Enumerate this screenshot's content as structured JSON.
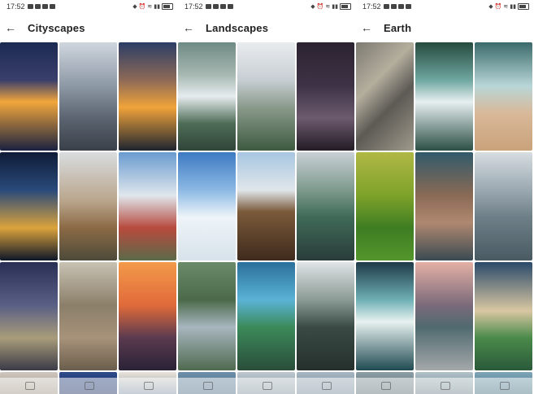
{
  "screens": [
    {
      "status_time": "17:52",
      "title": "Cityscapes",
      "tiles": [
        "linear-gradient(180deg,#1c2a52 0%,#3a3f6b 35%,#f2a63b 55%,#1a2140 100%)",
        "linear-gradient(180deg,#cfd6de 0%,#8e99a6 40%,#5b6470 70%,#3a4049 100%)",
        "linear-gradient(180deg,#2c3d66 0%,#8e6a57 35%,#f0a33a 60%,#1e2430 100%)",
        "linear-gradient(180deg,#0f1b37 0%,#294a7a 35%,#dba33c 70%,#0e1628 100%)",
        "linear-gradient(180deg,#d9dde0 0%,#b9a58c 45%,#8b6a45 70%,#4d4a3a 100%)",
        "linear-gradient(180deg,#6a9bd0 0%,#dfe6ec 40%,#b74a3e 70%,#5a6a48 100%)",
        "linear-gradient(180deg,#2a2f55 0%,#5a5f85 40%,#a89c7a 70%,#3b3a48 100%)",
        "linear-gradient(180deg,#c8c2b3 0%,#8b7f6a 40%,#a8927a 70%,#6a5e4c 100%)",
        "linear-gradient(180deg,#f39a4a 0%,#e06a3a 40%,#5a3a4f 70%,#2a2236 100%)",
        "linear-gradient(180deg,#cfc7be 0%,#9a8e80 100%)",
        "linear-gradient(180deg,#2e4a8a 0%,#1c2f60 100%)",
        "linear-gradient(180deg,#e9e2d8 0%,#7a8ea0 100%)"
      ]
    },
    {
      "status_time": "17:52",
      "title": "Landscapes",
      "tiles": [
        "linear-gradient(180deg,#6f8a84 0%,#a7b8b2 30%,#e6ecee 50%,#4e6c57 75%,#2f4538 100%)",
        "linear-gradient(180deg,#e9ecef 0%,#c7ced3 35%,#8a9a8c 60%,#3d5a3f 100%)",
        "linear-gradient(180deg,#2b2230 0%,#3e3346 40%,#6c5a6e 70%,#231b25 100%)",
        "linear-gradient(180deg,#3d7ac2 0%,#8cb9e4 35%,#eef4f8 60%,#d7e2ea 100%)",
        "linear-gradient(180deg,#a7c6e1 0%,#e0e6ea 35%,#7a5a3a 55%,#3f2a1d 100%)",
        "linear-gradient(180deg,#c9d0d5 0%,#7e9a8d 35%,#3f6a57 60%,#2a3c3a 100%)",
        "linear-gradient(180deg,#6a8a6a 0%,#4c6a4a 35%,#a8b6bf 60%,#4f6a4f 100%)",
        "linear-gradient(180deg,#2b6f9a 0%,#5ab3d6 35%,#3c8a5a 60%,#2a4d3a 100%)",
        "linear-gradient(180deg,#e0e4e6 0%,#8a9a94 35%,#3a4a44 60%,#25302c 100%)",
        "linear-gradient(180deg,#6d8fa9 0%,#4b6b82 100%)",
        "linear-gradient(180deg,#bcc7cf 0%,#7f8f99 100%)",
        "linear-gradient(180deg,#a7b7c3 0%,#6f8492 100%)"
      ]
    },
    {
      "status_time": "17:52",
      "title": "Earth",
      "tiles": [
        "linear-gradient(135deg,#7d7a72 0%,#b4ae9d 35%,#5d5a55 60%,#9f9a8c 100%)",
        "linear-gradient(180deg,#264a3e 0%,#6fa7a1 35%,#e6eff0 55%,#2c4f44 100%)",
        "linear-gradient(180deg,#3b6a6a 0%,#b8d6d8 40%,#d8b99a 65%,#c9a27a 100%)",
        "linear-gradient(180deg,#b0b844 0%,#7ea22a 40%,#3e7d22 70%,#54962c 100%)",
        "linear-gradient(180deg,#315a6b 0%,#8a6a55 40%,#b08870 65%,#3a4a52 100%)",
        "linear-gradient(180deg,#d7dde1 0%,#9aa8b1 35%,#6e7f88 60%,#4a5a63 100%)",
        "linear-gradient(180deg,#1e3a48 0%,#6fb0b5 35%,#e8f2f0 55%,#1f4a52 100%)",
        "linear-gradient(180deg,#e4b0a5 0%,#7a6a7a 40%,#506a70 60%,#a4a8aa 100%)",
        "linear-gradient(180deg,#2a4a6a 0%,#d9c7a2 45%,#4a8a4a 70%,#2a5a3a 100%)",
        "linear-gradient(180deg,#8c9ea6 0%,#5a6a70 100%)",
        "linear-gradient(180deg,#b1c2c9 0%,#6a7f86 100%)",
        "linear-gradient(180deg,#7fa6b8 0%,#3f6a7a 100%)"
      ]
    }
  ]
}
